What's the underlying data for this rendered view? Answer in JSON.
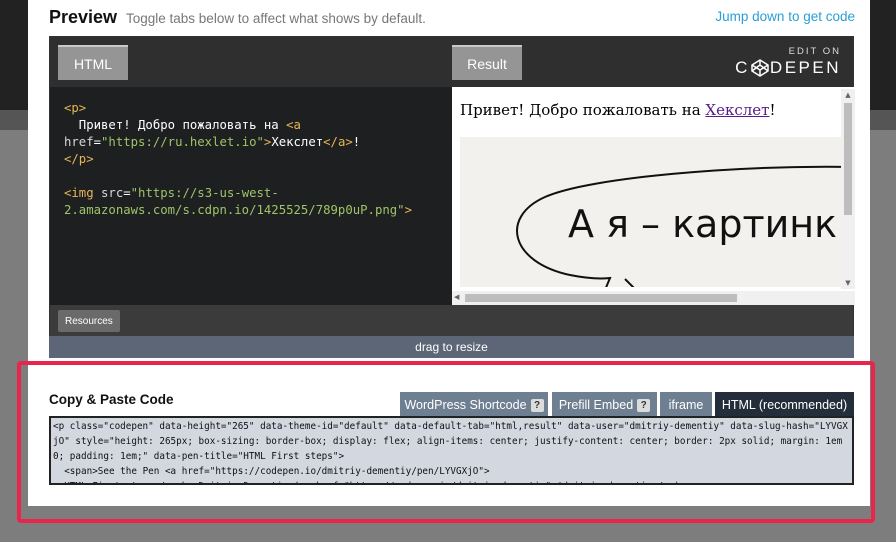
{
  "preview": {
    "title": "Preview",
    "subtitle": "Toggle tabs below to affect what shows by default.",
    "jump_link": "Jump down to get code"
  },
  "embed": {
    "tabs": {
      "html": "HTML",
      "result": "Result"
    },
    "edit_on": "EDIT ON",
    "brand": "CODEPEN",
    "code_lines": [
      "<p>",
      "  Привет! Добро пожаловать на <a",
      "href=\"https://ru.hexlet.io\">Хекслет</a>!",
      "</p>",
      "",
      "<img src=\"https://s3-us-west-",
      "2.amazonaws.com/s.cdpn.io/1425525/789p0uP.png\">"
    ],
    "result": {
      "text_before": "Привет! Добро пожаловать на ",
      "link_text": "Хекслет",
      "text_after": "!",
      "image_text": "А я – картинк"
    },
    "resources_button": "Resources",
    "drag_label": "drag to resize"
  },
  "copy": {
    "title": "Copy & Paste Code",
    "tabs": [
      {
        "label": "WordPress Shortcode",
        "help": "?"
      },
      {
        "label": "Prefill Embed",
        "help": "?"
      },
      {
        "label": "iframe"
      },
      {
        "label": "HTML (recommended)",
        "active": true
      }
    ],
    "code": "<p class=\"codepen\" data-height=\"265\" data-theme-id=\"default\" data-default-tab=\"html,result\" data-user=\"dmitriy-dementiy\" data-slug-hash=\"LYVGXjO\" style=\"height: 265px; box-sizing: border-box; display: flex; align-items: center; justify-content: center; border: 2px solid; margin: 1em 0; padding: 1em;\" data-pen-title=\"HTML First steps\">\n  <span>See the Pen <a href=\"https://codepen.io/dmitriy-dementiy/pen/LYVGXjO\">\n  HTML First steps</a> by Dmitriy Dementiy (<a href=\"https://codepen.io/dmitriy-dementiy\">@dmitriy-dementiy</a>)"
  },
  "colors": {
    "highlight_border": "#e8264c",
    "link": "#2a9fd6",
    "active_tab": "#232e3a",
    "inactive_tab": "#6f7f92"
  }
}
